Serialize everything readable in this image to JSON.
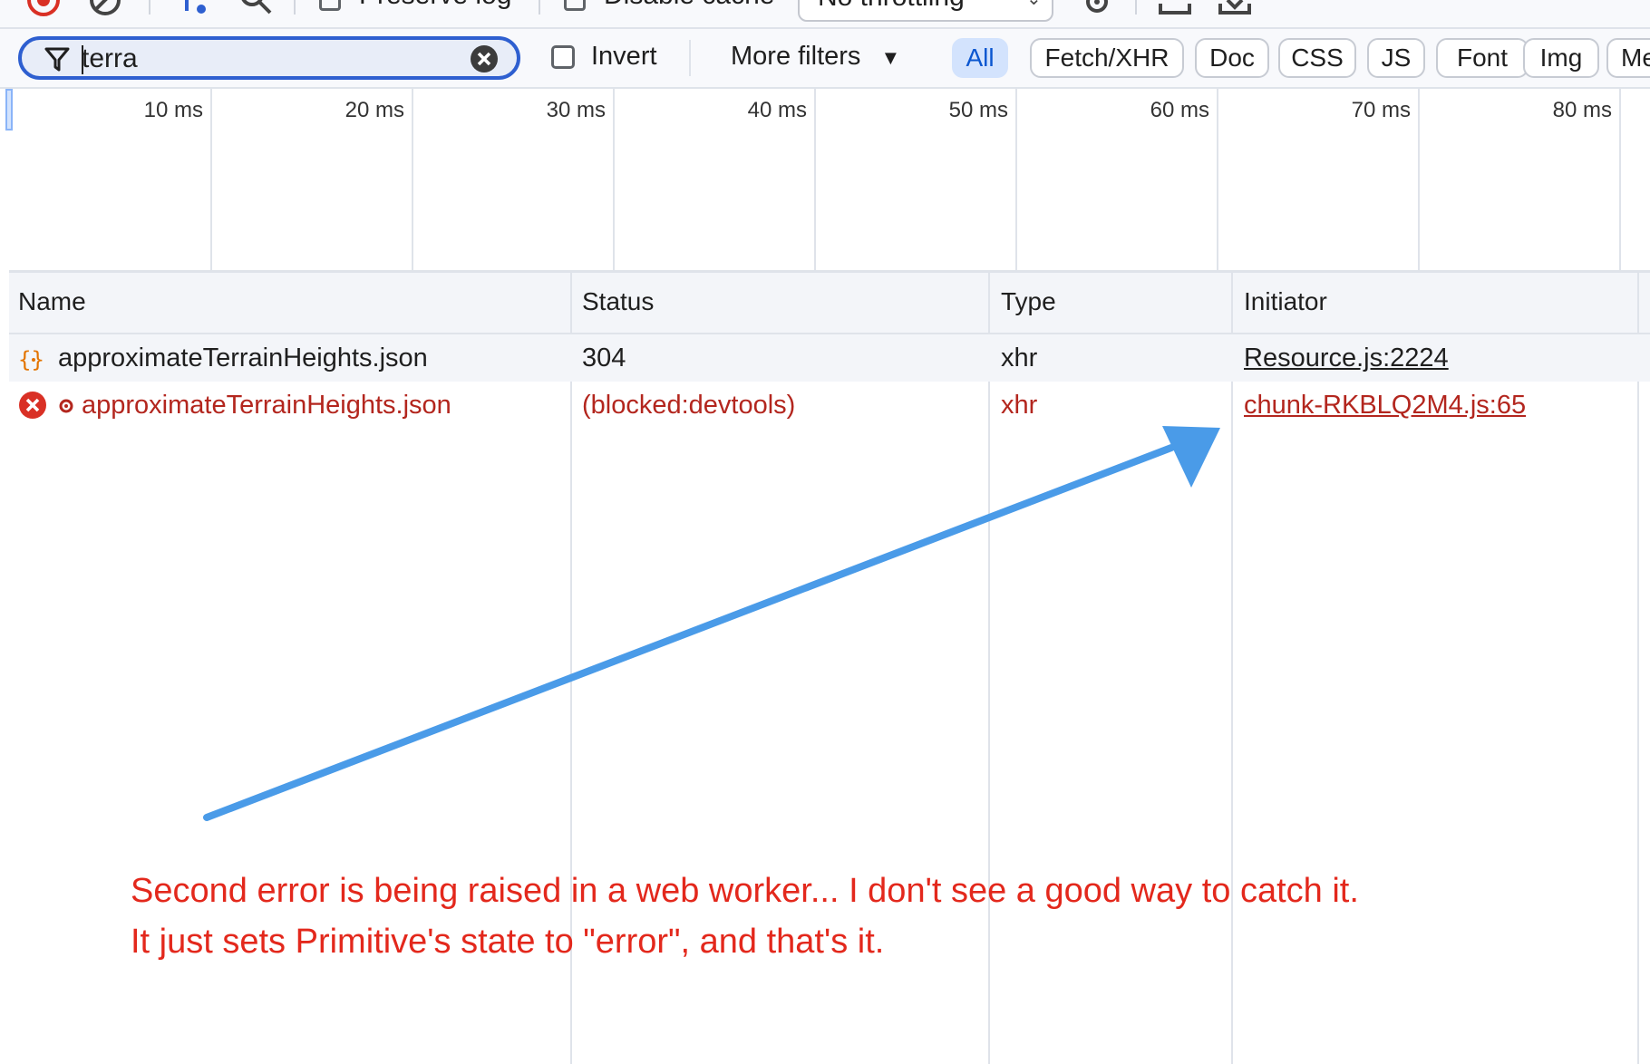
{
  "toolbar": {
    "preserve_log_label": "Preserve log",
    "disable_cache_label": "Disable cache",
    "throttling_value": "No throttling"
  },
  "filter": {
    "value": "terra",
    "invert_label": "Invert",
    "more_filters_label": "More filters",
    "types": [
      "All",
      "Fetch/XHR",
      "Doc",
      "CSS",
      "JS",
      "Font",
      "Img",
      "Me"
    ],
    "active_type": "All"
  },
  "timeline": {
    "ticks": [
      "10 ms",
      "20 ms",
      "30 ms",
      "40 ms",
      "50 ms",
      "60 ms",
      "70 ms",
      "80 ms"
    ]
  },
  "table": {
    "columns": [
      "Name",
      "Status",
      "Type",
      "Initiator"
    ],
    "rows": [
      {
        "name": "approximateTerrainHeights.json",
        "status": "304",
        "type": "xhr",
        "initiator": "Resource.js:2224",
        "error": false
      },
      {
        "name": "approximateTerrainHeights.json",
        "status": "(blocked:devtools)",
        "type": "xhr",
        "initiator": "chunk-RKBLQ2M4.js:65",
        "error": true
      }
    ]
  },
  "annotation": {
    "line1": "Second error is being raised in a web worker... I don't see a good way to catch it.",
    "line2": "It just sets Primitive's state to \"error\", and that's it.",
    "arrow_color": "#4a9be8",
    "text_color": "#e3281c"
  },
  "colors": {
    "accent": "#2e5fd0",
    "error": "#b3261e",
    "active_chip_bg": "#d3e3fd"
  }
}
